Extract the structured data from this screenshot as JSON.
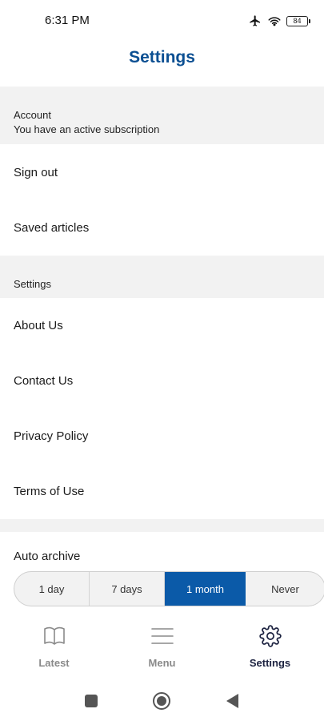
{
  "status_bar": {
    "time": "6:31 PM",
    "battery": "84",
    "icons": [
      "airplane-icon",
      "wifi-icon",
      "battery-icon"
    ]
  },
  "header": {
    "title": "Settings"
  },
  "account_section": {
    "title": "Account",
    "subtitle": "You have an active subscription",
    "items": [
      {
        "label": "Sign out"
      },
      {
        "label": "Saved articles"
      }
    ]
  },
  "settings_section": {
    "title": "Settings",
    "items": [
      {
        "label": "About Us"
      },
      {
        "label": "Contact Us"
      },
      {
        "label": "Privacy Policy"
      },
      {
        "label": "Terms of Use"
      }
    ]
  },
  "auto_archive": {
    "label": "Auto archive",
    "options": [
      "1 day",
      "7 days",
      "1 month",
      "Never"
    ],
    "selected": "1 month"
  },
  "tab_bar": {
    "tabs": [
      {
        "label": "Latest",
        "icon": "book-icon"
      },
      {
        "label": "Menu",
        "icon": "hamburger-menu-icon"
      },
      {
        "label": "Settings",
        "icon": "gear-icon"
      }
    ],
    "active": "Settings"
  },
  "colors": {
    "brand": "#0b4f92",
    "accent": "#0b5aa8",
    "section_bg": "#f2f2f2",
    "active_tab": "#1c2240",
    "inactive_tab": "#8a8a8a"
  }
}
